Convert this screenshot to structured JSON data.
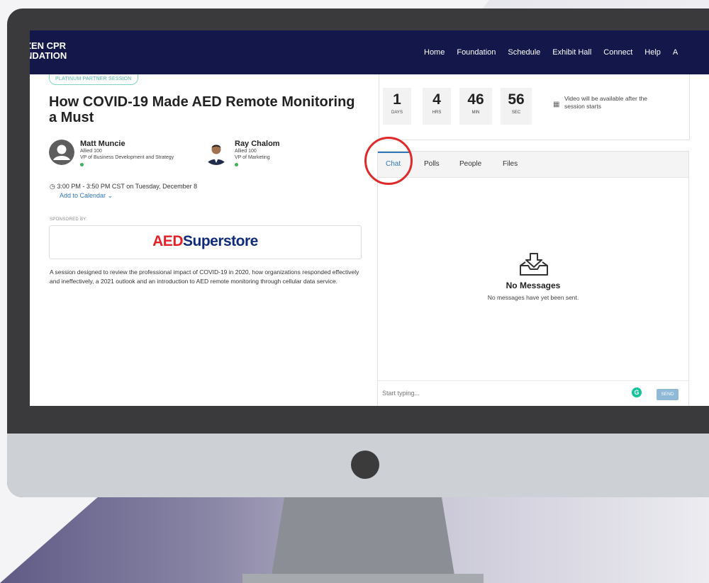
{
  "header": {
    "logo_line1": "ZEN CPR",
    "logo_line2": "NDATION",
    "nav": [
      "Home",
      "Foundation",
      "Schedule",
      "Exhibit Hall",
      "Connect",
      "Help",
      "A"
    ]
  },
  "session": {
    "badge": "PLATINUM PARTNER SESSION",
    "title": "How COVID-19 Made AED Remote Monitoring a Must",
    "speakers": [
      {
        "name": "Matt Muncie",
        "org": "Allied 100",
        "role": "VP of Business Development and Strategy"
      },
      {
        "name": "Ray Chalom",
        "org": "Allied 100",
        "role": "VP of Marketing"
      }
    ],
    "time": "3:00 PM - 3:50 PM CST on Tuesday, December 8",
    "add_calendar": "Add to Calendar ⌄",
    "sponsored_by": "SPONSORED BY:",
    "sponsor_logo_a": "AED",
    "sponsor_logo_b": "Superstore",
    "description": "A session designed to review the professional impact of COVID-19 in 2020, how organizations responded effectively and ineffectively, a 2021 outlook and an introduction to AED remote monitoring through cellular data service."
  },
  "countdown": {
    "items": [
      {
        "value": "1",
        "label": "DAYS"
      },
      {
        "value": "4",
        "label": "HRS"
      },
      {
        "value": "46",
        "label": "MIN"
      },
      {
        "value": "56",
        "label": "SEC"
      }
    ],
    "video_note": "Video will be available after the session starts"
  },
  "chat": {
    "tabs": [
      "Chat",
      "Polls",
      "People",
      "Files"
    ],
    "active_tab": "Chat",
    "empty_title": "No Messages",
    "empty_sub": "No messages have yet been sent.",
    "input_placeholder": "Start typing...",
    "send_label": "SEND",
    "grammarly": "G"
  },
  "colors": {
    "navbar": "#13174a",
    "accent": "#2f77b6",
    "highlight_circle": "#e02a2a",
    "online": "#3cb15a"
  }
}
